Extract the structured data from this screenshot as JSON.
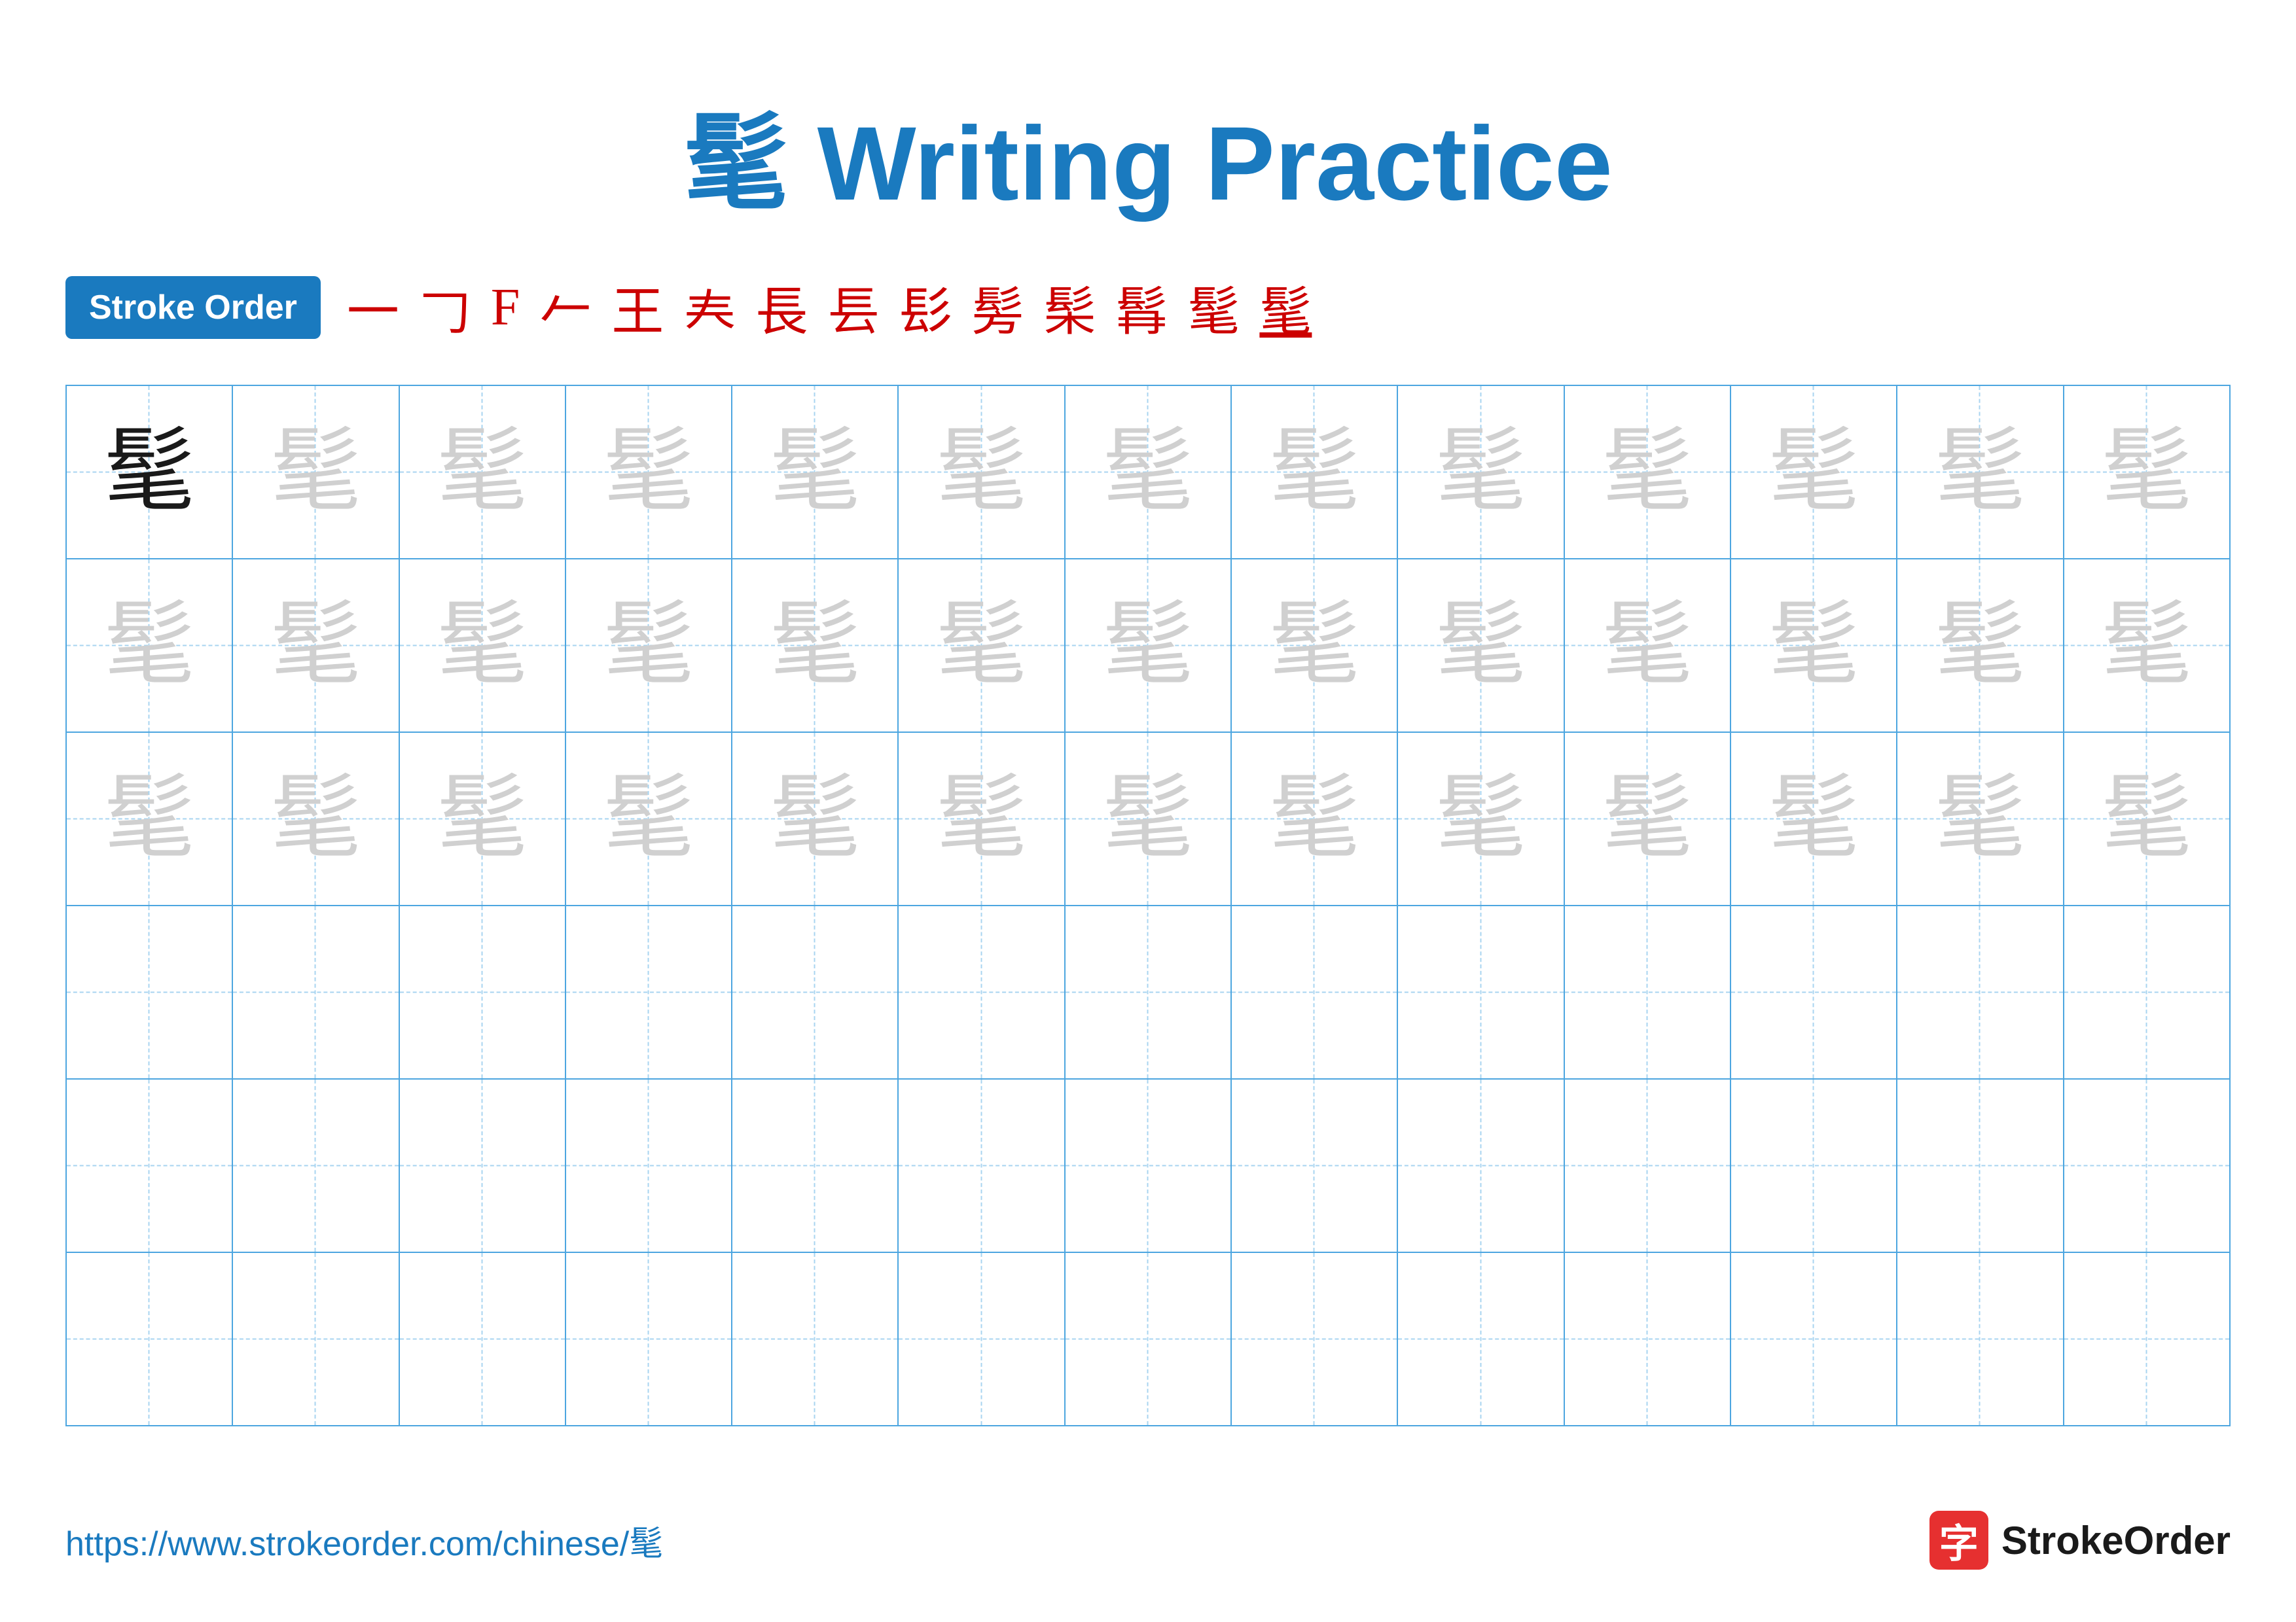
{
  "title": {
    "char": "髦",
    "label": " Writing Practice"
  },
  "stroke_order": {
    "badge_label": "Stroke Order",
    "strokes": [
      "一",
      "𠃌",
      "𠃍",
      "𠂉",
      "王",
      "𡗗",
      "長",
      "長́",
      "髟́",
      "髡",
      "髦̂",
      "髦̃",
      "髦̄",
      "髦"
    ]
  },
  "grid": {
    "rows": 6,
    "cols": 13,
    "example_char": "髦",
    "row_types": [
      "black-gray",
      "gray-light",
      "gray-light",
      "empty",
      "empty",
      "empty"
    ]
  },
  "footer": {
    "url": "https://www.strokeorder.com/chinese/髦",
    "logo_char": "字",
    "logo_label": "StrokeOrder"
  }
}
